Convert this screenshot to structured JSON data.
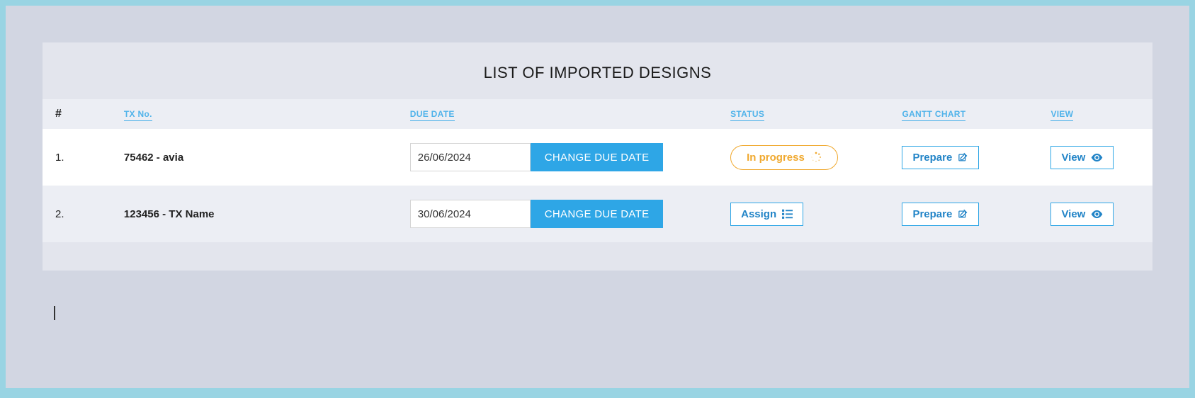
{
  "title": "LIST OF IMPORTED DESIGNS",
  "columns": {
    "idx": "#",
    "txno": "TX No.",
    "duedate": "DUE DATE",
    "status": "STATUS",
    "gantt": "GANTT CHART",
    "view": "VIEW"
  },
  "buttons": {
    "change_due": "CHANGE DUE DATE",
    "prepare": "Prepare",
    "view": "View",
    "assign": "Assign"
  },
  "rows": [
    {
      "idx": "1.",
      "tx": "75462 - avia",
      "due": "26/06/2024",
      "status_type": "progress",
      "status_label": "In progress"
    },
    {
      "idx": "2.",
      "tx": "123456 - TX Name",
      "due": "30/06/2024",
      "status_type": "assign",
      "status_label": "Assign"
    }
  ]
}
